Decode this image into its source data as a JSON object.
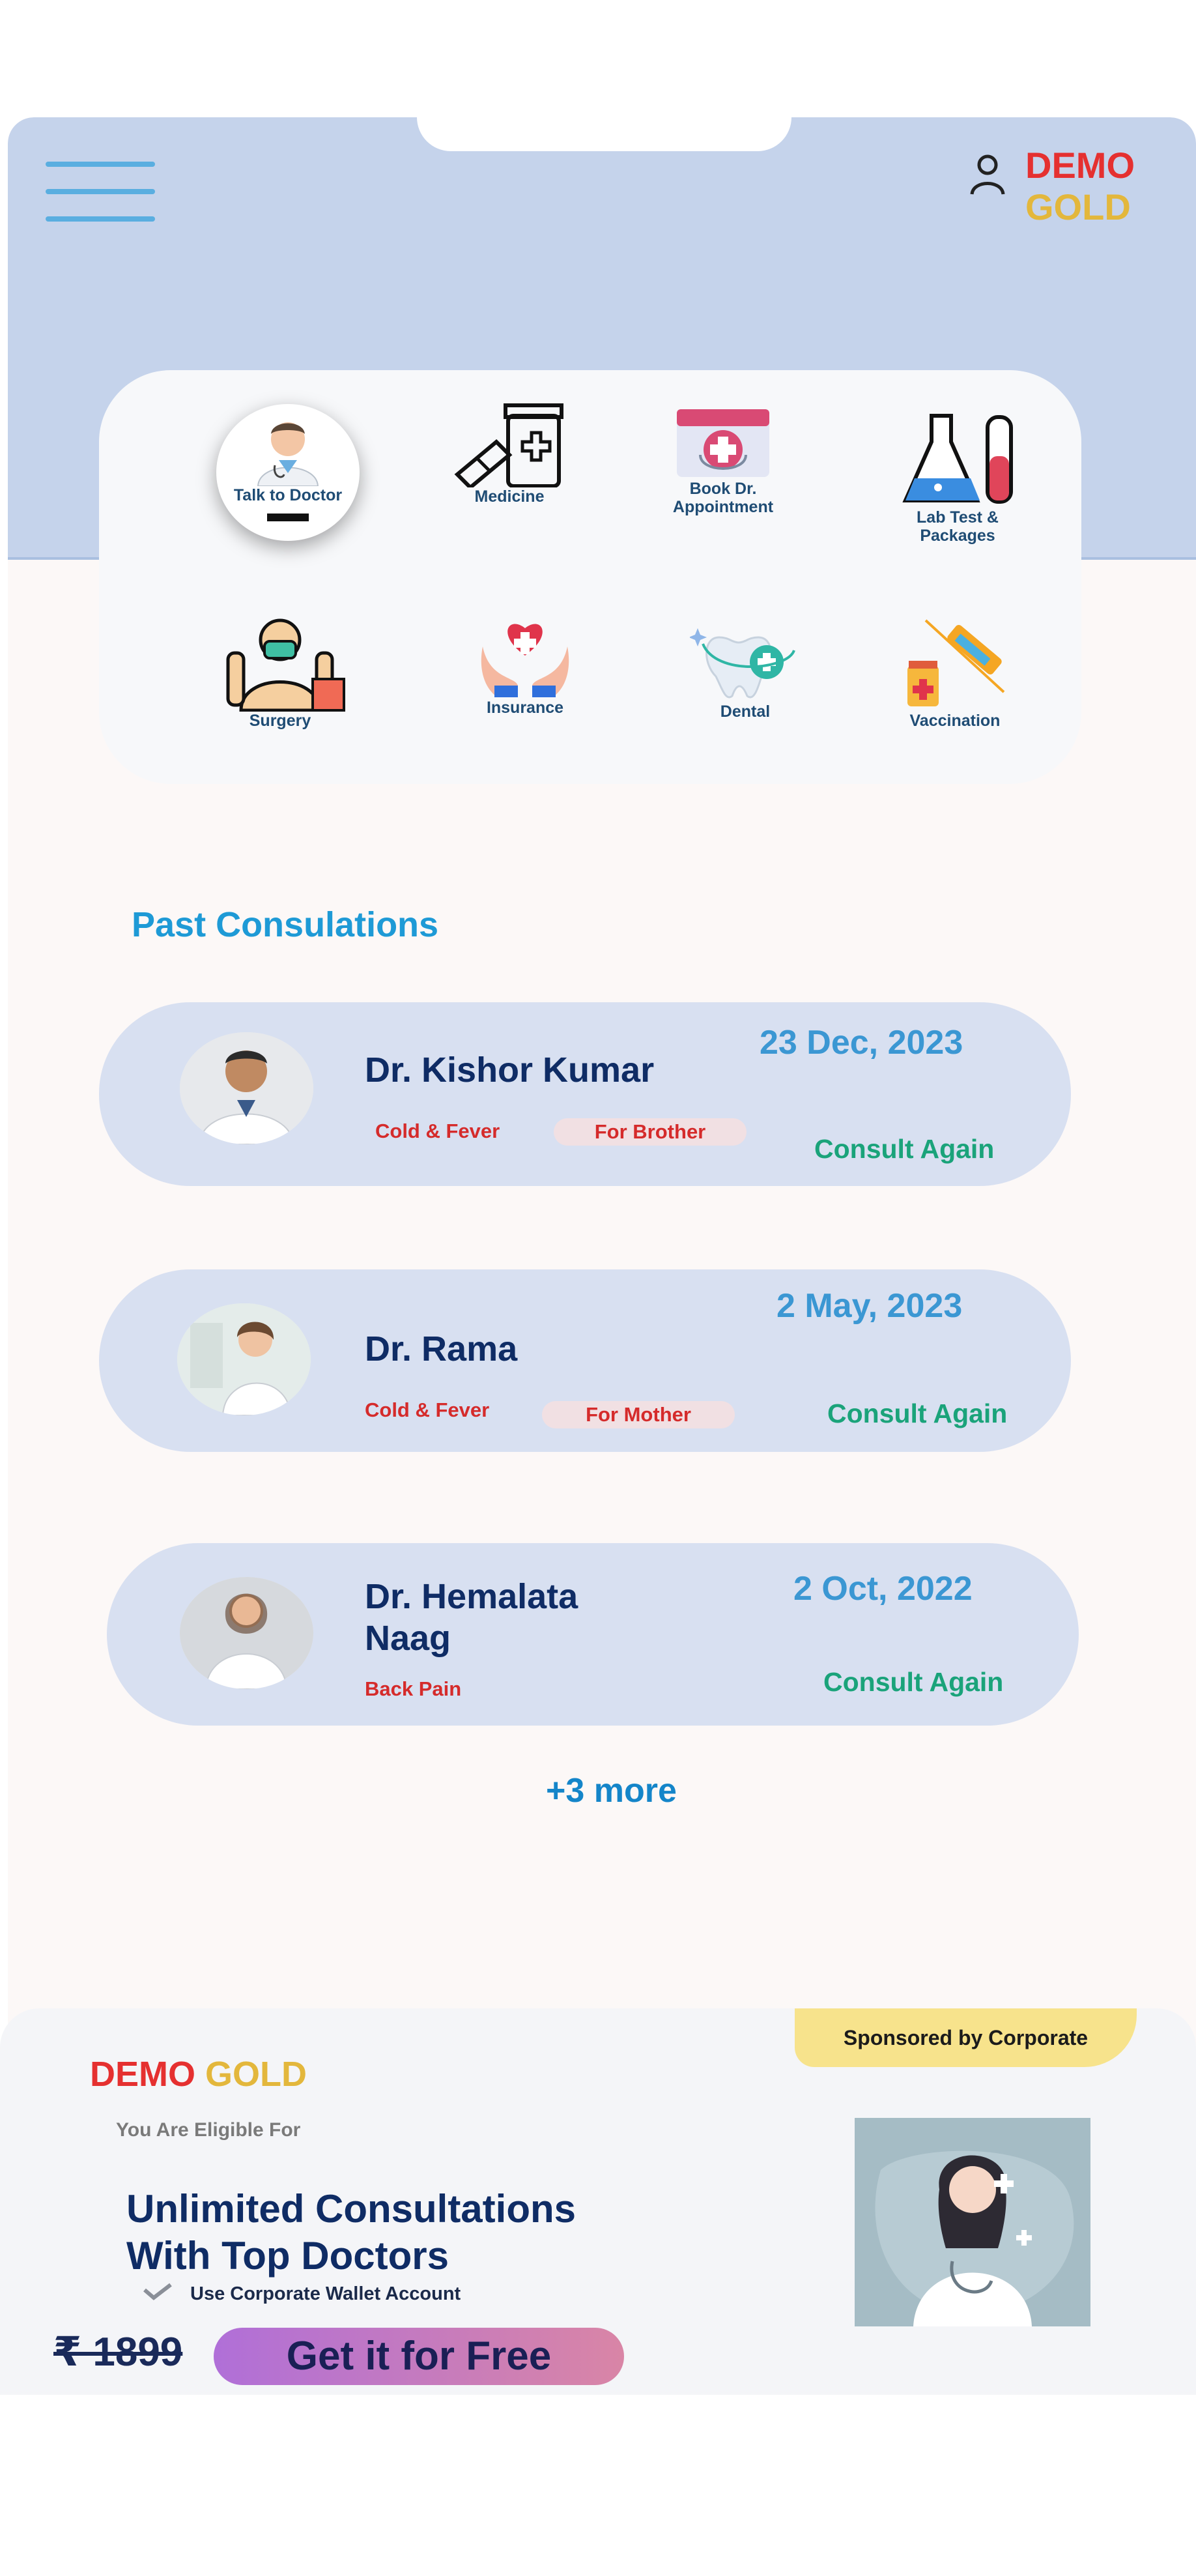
{
  "header": {
    "brand_demo": "DEMO",
    "brand_gold": "GOLD",
    "menu_icon": "hamburger-menu-icon",
    "profile_icon": "user-profile-icon"
  },
  "services": [
    {
      "label": "Talk to Doctor",
      "icon": "doctor-icon",
      "active": true
    },
    {
      "label": "Medicine",
      "icon": "medicine-icon"
    },
    {
      "label": "Book Dr. Appointment",
      "icon": "calendar-appointment-icon"
    },
    {
      "label": "Lab Test & Packages",
      "icon": "lab-flask-icon"
    },
    {
      "label": "Surgery",
      "icon": "surgeon-icon"
    },
    {
      "label": "Insurance",
      "icon": "heart-hands-icon"
    },
    {
      "label": "Dental",
      "icon": "tooth-icon"
    },
    {
      "label": "Vaccination",
      "icon": "syringe-icon"
    }
  ],
  "past_consultations": {
    "title": "Past Consulations",
    "items": [
      {
        "doctor": "Dr. Kishor Kumar",
        "date": "23 Dec, 2023",
        "condition": "Cold & Fever",
        "for": "For Brother",
        "action": "Consult Again"
      },
      {
        "doctor": "Dr. Rama",
        "date": "2 May, 2023",
        "condition": "Cold & Fever",
        "for": "For Mother",
        "action": "Consult Again"
      },
      {
        "doctor": "Dr. Hemalata Naag",
        "date": "2 Oct, 2022",
        "condition": "Back Pain",
        "action": "Consult Again"
      }
    ],
    "more": "+3 more"
  },
  "promo": {
    "sponsor": "Sponsored by Corporate",
    "brand_demo": "DEMO",
    "brand_gold": "GOLD",
    "eligible": "You Are Eligible For",
    "headline_line1": "Unlimited Consultations",
    "headline_line2": "With Top Doctors",
    "wallet_note": "Use Corporate Wallet Account",
    "old_price": "₹ 1899",
    "cta": "Get it for Free"
  },
  "colors": {
    "header_bg": "#c5d3eb",
    "brand_red": "#e53030",
    "brand_gold": "#e3b73c",
    "title_blue": "#1e9ad6",
    "consult_green": "#1aa37a"
  }
}
